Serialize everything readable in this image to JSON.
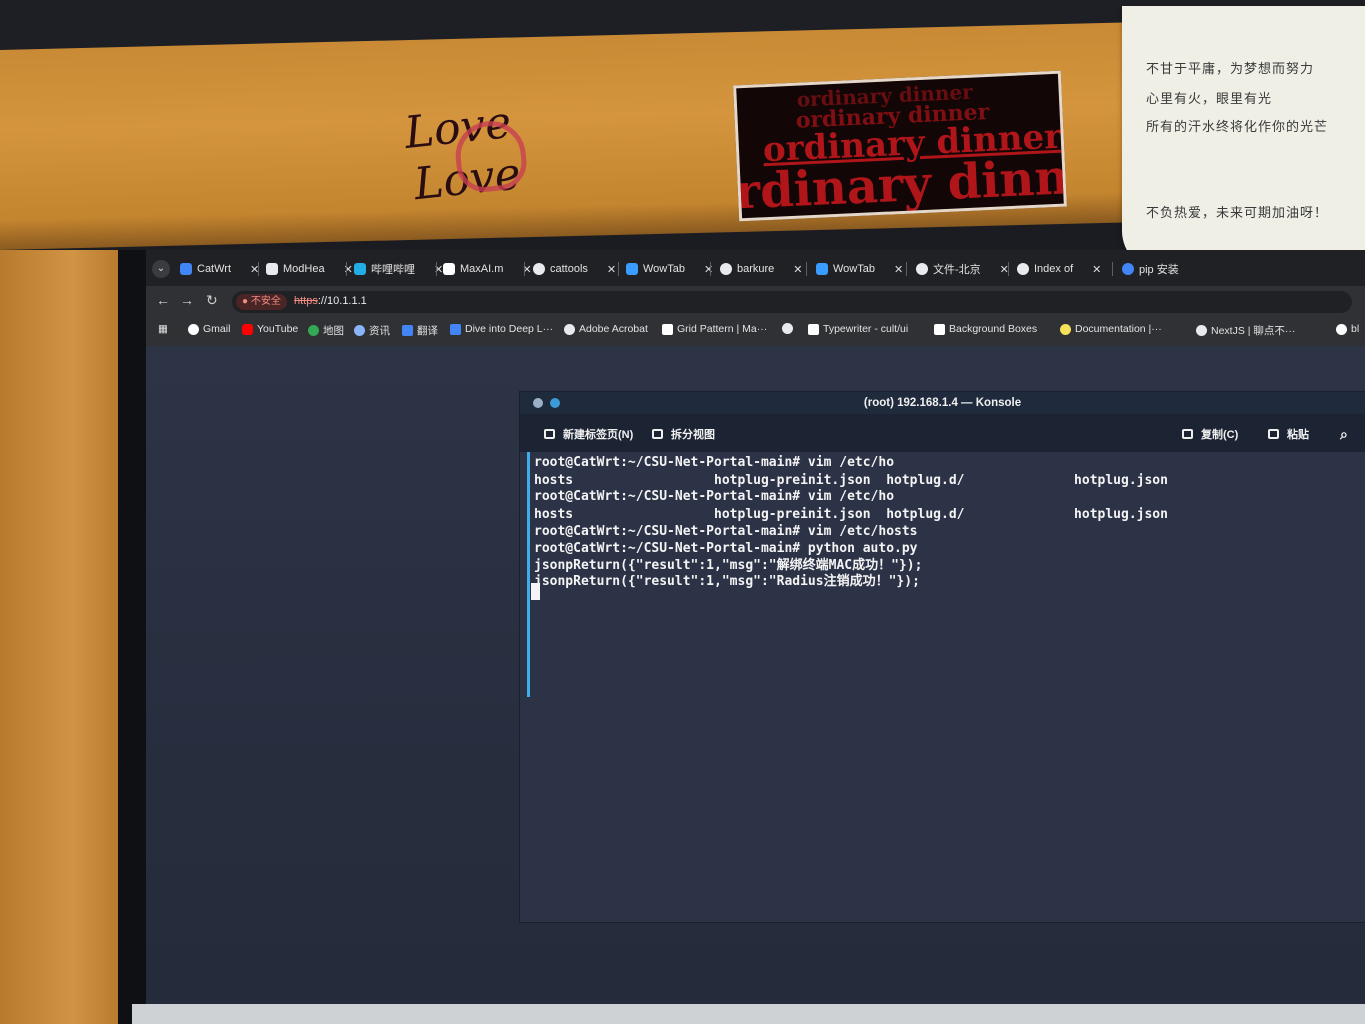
{
  "stickers": {
    "love_line1": "Love",
    "love_line2": "Love",
    "ordinary": [
      "ordinary dinner",
      "ordinary dinner",
      "ordinary dinner",
      "rdinary dinn"
    ]
  },
  "note_lines": [
    "不甘于平庸，为梦想而努力",
    "心里有火，眼里有光",
    "所有的汗水终将化作你的光芒",
    "不负热爱，未来可期加油呀！"
  ],
  "browser": {
    "tabs_button_icon": "chevron-down-icon",
    "tabs": [
      {
        "label": "CatWrt",
        "icon_color": "#4285f4"
      },
      {
        "label": "ModHea",
        "icon_color": "#e8eaed"
      },
      {
        "label": "哔哩哔哩",
        "icon_color": "#23ade5"
      },
      {
        "label": "MaxAI.m",
        "icon_color": "#ffffff"
      },
      {
        "label": "cattools",
        "icon_color": "#e8eaed"
      },
      {
        "label": "WowTab",
        "icon_color": "#3b9cff"
      },
      {
        "label": "barkure",
        "icon_color": "#e8eaed"
      },
      {
        "label": "WowTab",
        "icon_color": "#3b9cff"
      },
      {
        "label": "文件-北京",
        "icon_color": "#e8eaed"
      },
      {
        "label": "Index of",
        "icon_color": "#e8eaed"
      },
      {
        "label": "pip 安装",
        "icon_color": "#4285f4"
      }
    ],
    "security_label": "不安全",
    "url_scheme": "https",
    "url_rest": "://10.1.1.1",
    "bookmarks": [
      {
        "label": "Gmail",
        "icon_color": "#ffffff"
      },
      {
        "label": "YouTube",
        "icon_color": "#ff0000"
      },
      {
        "label": "地图",
        "icon_color": "#34a853"
      },
      {
        "label": "资讯",
        "icon_color": "#8ab4f8"
      },
      {
        "label": "翻译",
        "icon_color": "#4285f4"
      },
      {
        "label": "Dive into Deep L···",
        "icon_color": "#4285f4"
      },
      {
        "label": "Adobe Acrobat",
        "icon_color": "#e8eaed"
      },
      {
        "label": "Grid Pattern | Ma···",
        "icon_color": "#ffffff"
      },
      {
        "label": "",
        "icon_color": "#e8eaed"
      },
      {
        "label": "Typewriter - cult/ui",
        "icon_color": "#ffffff"
      },
      {
        "label": "Background Boxes",
        "icon_color": "#ffffff"
      },
      {
        "label": "Documentation |···",
        "icon_color": "#f7e05a"
      },
      {
        "label": "NextJS | 聊点不···",
        "icon_color": "#e8eaed"
      },
      {
        "label": "bl",
        "icon_color": "#ffffff"
      }
    ]
  },
  "konsole": {
    "title": "(root) 192.168.1.4 — Konsole",
    "new_tab_label": "新建标签页(N)",
    "split_view_label": "拆分视图",
    "copy_label": "复制(C)",
    "paste_label": "粘贴",
    "search_icon": "search-icon",
    "lines": [
      "root@CatWrt:~/CSU-Net-Portal-main# vim /etc/ho",
      "hosts                  hotplug-preinit.json  hotplug.d/              hotplug.json",
      "root@CatWrt:~/CSU-Net-Portal-main# vim /etc/ho",
      "hosts                  hotplug-preinit.json  hotplug.d/              hotplug.json",
      "root@CatWrt:~/CSU-Net-Portal-main# vim /etc/hosts",
      "root@CatWrt:~/CSU-Net-Portal-main# python auto.py",
      "jsonpReturn({\"result\":1,\"msg\":\"解绑终端MAC成功！\"});",
      "jsonpReturn({\"result\":1,\"msg\":\"Radius注销成功！\"});"
    ]
  }
}
